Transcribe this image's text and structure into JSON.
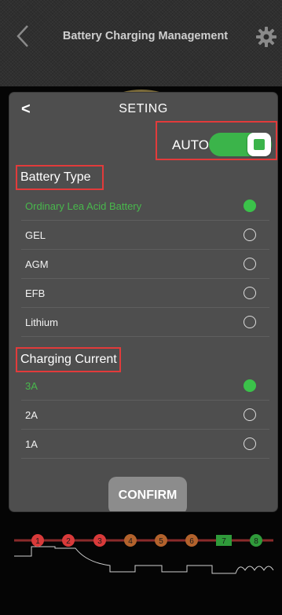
{
  "app": {
    "title": "Battery Charging Management",
    "icons": {
      "back": "chevron-left-icon",
      "settings": "gear-icon"
    }
  },
  "stages": {
    "labels": [
      "1",
      "2",
      "3",
      "4",
      "5",
      "6",
      "7",
      "8"
    ],
    "colors": {
      "active": "#d93a3a",
      "inactive": "#b3622c",
      "battery": "#2f9a3a",
      "final": "#2f9a3a"
    }
  },
  "modal": {
    "back_symbol": "<",
    "title": "SETING",
    "auto": {
      "label": "AUTO",
      "on": true
    },
    "battery_type": {
      "title": "Battery Type",
      "options": [
        {
          "label": "Ordinary Lea Acid Battery",
          "selected": true
        },
        {
          "label": "GEL",
          "selected": false
        },
        {
          "label": "AGM",
          "selected": false
        },
        {
          "label": "EFB",
          "selected": false
        },
        {
          "label": "Lithium",
          "selected": false
        }
      ]
    },
    "charging_current": {
      "title": "Charging Current",
      "options": [
        {
          "label": "3A",
          "selected": true
        },
        {
          "label": "2A",
          "selected": false
        },
        {
          "label": "1A",
          "selected": false
        }
      ]
    },
    "confirm_label": "CONFIRM"
  },
  "colors": {
    "accent_green": "#3bb44a",
    "highlight_red": "#e23b3b",
    "modal_bg": "#4e4e4e"
  }
}
